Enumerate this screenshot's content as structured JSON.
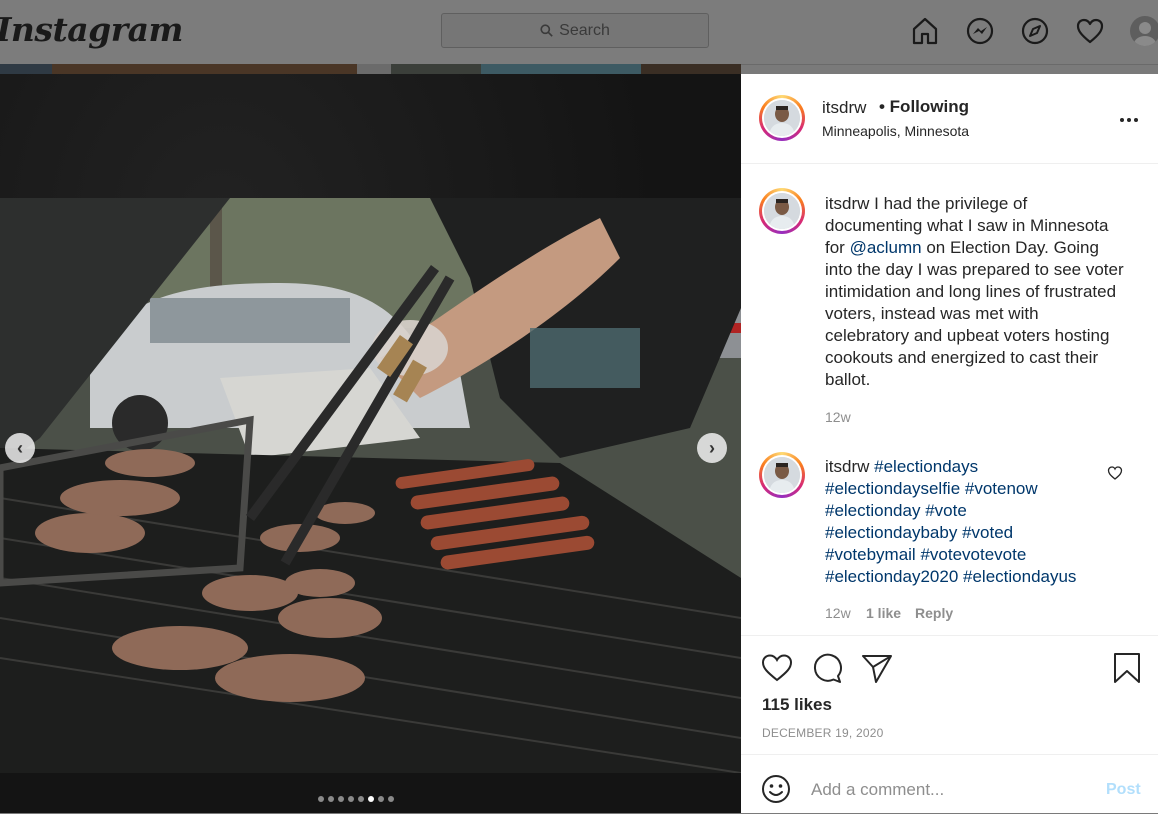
{
  "nav": {
    "logo": "Instagram",
    "search_placeholder": "Search",
    "icons": [
      "home-icon",
      "messenger-icon",
      "explore-icon",
      "activity-heart-icon",
      "profile-avatar"
    ]
  },
  "post": {
    "author": "itsdrw",
    "follow_status": "• Following",
    "location": "Minneapolis, Minnesota",
    "carousel": {
      "total_slides": 8,
      "active_slide": 6
    },
    "caption": {
      "username": "itsdrw",
      "text_before_mention": " I had the privilege of documenting what I saw in Minnesota for ",
      "mention": "@aclumn",
      "text_after_mention": " on Election Day. Going into the day I was prepared to see voter intimidation and long lines of frustrated voters, instead was met with celebratory and upbeat voters hosting cookouts and energized to cast their ballot.",
      "time": "12w"
    },
    "comment": {
      "username": "itsdrw",
      "hashtags": [
        "#electiondays",
        "#electiondayselfie",
        "#votenow",
        "#electionday",
        "#vote",
        "#electiondaybaby",
        "#voted",
        "#votebymail",
        "#votevotevote",
        "#electionday2020",
        "#electiondayus"
      ],
      "time": "12w",
      "likes": "1 like",
      "reply_label": "Reply"
    },
    "likes": "115 likes",
    "date": "DECEMBER 19, 2020",
    "add_comment_placeholder": "Add a comment...",
    "post_button": "Post"
  },
  "colors": {
    "link": "#00376b",
    "muted": "#8e8e8e",
    "post_disabled": "#b2dffc"
  }
}
